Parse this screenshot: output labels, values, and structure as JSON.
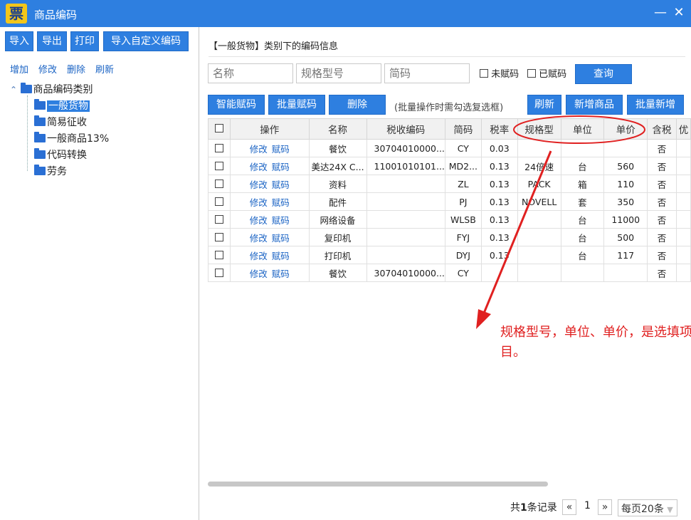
{
  "window": {
    "title": "商品编码",
    "logo_char": "票",
    "minimize": "—",
    "close": "✕"
  },
  "left": {
    "buttons": [
      "导入",
      "导出",
      "打印",
      "导入自定义编码"
    ],
    "links": [
      "增加",
      "修改",
      "删除",
      "刷新"
    ],
    "tree": {
      "toggle": "⌃",
      "root": "商品编码类别",
      "children": [
        "一般货物",
        "简易征收",
        "一般商品13%",
        "代码转换",
        "劳务"
      ],
      "selected_index": 0
    }
  },
  "main": {
    "info": "【一般货物】类别下的编码信息",
    "search": {
      "name_placeholder": "名称",
      "spec_placeholder": "规格型号",
      "code_placeholder": "简码",
      "unassigned_label": "未赋码",
      "assigned_label": "已赋码",
      "query_button": "查询"
    },
    "toolbar": {
      "smart_assign": "智能赋码",
      "batch_assign": "批量赋码",
      "delete": "删除",
      "hint": "(批量操作时需勾选复选框)",
      "refresh": "刷新",
      "add_product": "新增商品",
      "batch_add": "批量新增"
    },
    "table": {
      "headers": [
        "操作",
        "名称",
        "税收编码",
        "简码",
        "税率",
        "规格型",
        "单位",
        "单价",
        "含税",
        "优"
      ],
      "op_edit": "修改",
      "op_assign": "赋码",
      "rows": [
        [
          "餐饮",
          "30704010000...",
          "CY",
          "0.03",
          "",
          "",
          "",
          "否"
        ],
        [
          "美达24X C...",
          "11001010101...",
          "MD2...",
          "0.13",
          "24倍速",
          "台",
          "560",
          "否"
        ],
        [
          "资料",
          "",
          "ZL",
          "0.13",
          "PACK",
          "箱",
          "110",
          "否"
        ],
        [
          "配件",
          "",
          "PJ",
          "0.13",
          "NOVELL",
          "套",
          "350",
          "否"
        ],
        [
          "网络设备",
          "",
          "WLSB",
          "0.13",
          "",
          "台",
          "11000",
          "否"
        ],
        [
          "复印机",
          "",
          "FYJ",
          "0.13",
          "",
          "台",
          "500",
          "否"
        ],
        [
          "打印机",
          "",
          "DYJ",
          "0.13",
          "",
          "台",
          "117",
          "否"
        ],
        [
          "餐饮",
          "30704010000...",
          "CY",
          "",
          "",
          "",
          "",
          "否"
        ]
      ]
    },
    "pager": {
      "total_prefix": "共",
      "total_count": "1",
      "total_suffix": "条记录",
      "prev": "«",
      "page": "1",
      "next": "»",
      "page_size": "每页20条",
      "page_size_arrow": "▼"
    },
    "annotation": "规格型号，单位、单价，是选填项目。"
  },
  "colors": {
    "accent": "#2e7fe0",
    "annotation": "#e02020"
  }
}
